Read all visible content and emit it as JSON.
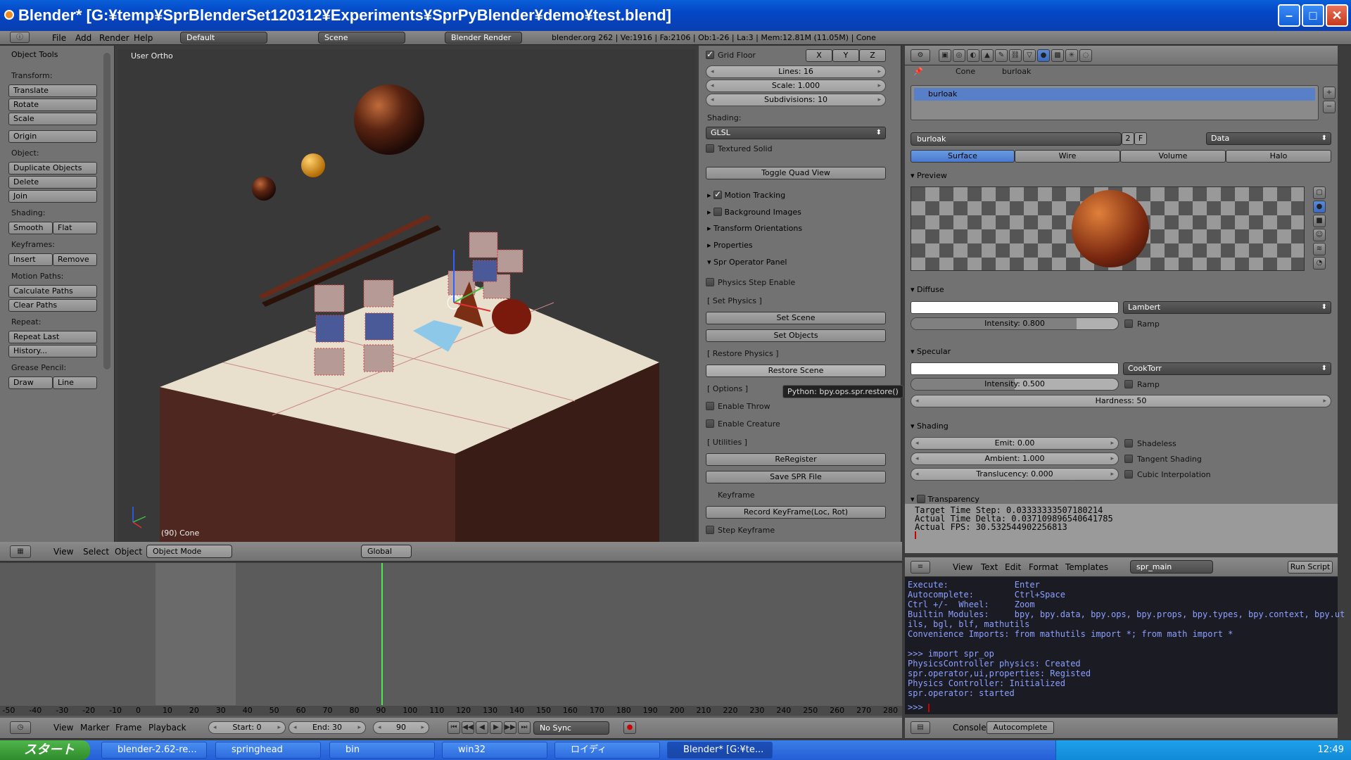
{
  "window": {
    "title": "Blender* [G:¥temp¥SprBlenderSet120312¥Experiments¥SprPyBlender¥demo¥test.blend]",
    "min": "–",
    "max": "□",
    "close": "✕"
  },
  "info_header": {
    "menus": [
      "File",
      "Add",
      "Render",
      "Help"
    ],
    "layout": "Default",
    "scene": "Scene",
    "engine": "Blender Render",
    "stats": "blender.org 262 | Ve:1916 | Fa:2106 | Ob:1-26 | La:3 | Mem:12.81M (11.05M) | Cone"
  },
  "tool_shelf": {
    "header": "Object Tools",
    "transform_label": "Transform:",
    "translate": "Translate",
    "rotate": "Rotate",
    "scale": "Scale",
    "origin": "Origin",
    "object_label": "Object:",
    "duplicate": "Duplicate Objects",
    "delete": "Delete",
    "join": "Join",
    "shading_label": "Shading:",
    "smooth": "Smooth",
    "flat": "Flat",
    "keyframes_label": "Keyframes:",
    "insert": "Insert",
    "remove": "Remove",
    "motion_label": "Motion Paths:",
    "calc_paths": "Calculate Paths",
    "clear_paths": "Clear Paths",
    "repeat_label": "Repeat:",
    "repeat_last": "Repeat Last",
    "history": "History...",
    "grease_label": "Grease Pencil:",
    "draw": "Draw",
    "line": "Line"
  },
  "viewport": {
    "view_name": "User Ortho",
    "object_info": "(90) Cone",
    "tooltip": "Python: bpy.ops.spr.restore()",
    "menus": [
      "View",
      "Select",
      "Object"
    ],
    "mode": "Object Mode",
    "orientation": "Global"
  },
  "properties_panel": {
    "grid_floor": "Grid Floor",
    "x": "X",
    "y": "Y",
    "z": "Z",
    "lines": "Lines: 16",
    "scale": "Scale: 1.000",
    "subdivisions": "Subdivisions: 10",
    "shading_label": "Shading:",
    "shading_value": "GLSL",
    "textured_solid": "Textured Solid",
    "toggle_quad": "Toggle Quad View",
    "motion_tracking": "Motion Tracking",
    "background_images": "Background Images",
    "transform_orientations": "Transform Orientations",
    "properties": "Properties",
    "spr_panel": "Spr Operator Panel",
    "physics_step": "Physics Step Enable",
    "set_physics": "[ Set Physics ]",
    "set_scene": "Set Scene",
    "set_objects": "Set Objects",
    "restore_physics": "[ Restore Physics ]",
    "restore_scene": "Restore Scene",
    "options": "[ Options ]",
    "enable_throw": "Enable Throw",
    "enable_creature": "Enable Creature",
    "utilities": "[ Utilities ]",
    "reregister": "ReRegister",
    "save_spr": "Save SPR File",
    "keyframe": "Keyframe",
    "record_keyframe": "Record KeyFrame(Loc, Rot)",
    "step_keyframe": "Step Keyframe"
  },
  "material": {
    "breadcrumb_cone": "Cone",
    "breadcrumb_mat": "burloak",
    "slot": "burloak",
    "name": "burloak",
    "users": "2",
    "fake": "F",
    "link": "Data",
    "tabs": [
      "Surface",
      "Wire",
      "Volume",
      "Halo"
    ],
    "preview": "Preview",
    "diffuse": "Diffuse",
    "diffuse_shader": "Lambert",
    "diffuse_intensity": "Intensity: 0.800",
    "diffuse_intensity_value": 0.8,
    "ramp": "Ramp",
    "specular": "Specular",
    "specular_shader": "CookTorr",
    "specular_intensity": "Intensity: 0.500",
    "specular_intensity_value": 0.5,
    "hardness": "Hardness: 50",
    "shading": "Shading",
    "emit": "Emit: 0.00",
    "ambient": "Ambient: 1.000",
    "translucency": "Translucency: 0.000",
    "shadeless": "Shadeless",
    "tangent": "Tangent Shading",
    "cubic": "Cubic Interpolation",
    "transparency": "Transparency"
  },
  "info_text": [
    "Target Time Step: 0.03333333507180214",
    "Actual Time Delta: 0.037109896540641785",
    "Actual FPS: 30.532544902256813"
  ],
  "text_editor": {
    "menus": [
      "View",
      "Text",
      "Edit",
      "Format",
      "Templates"
    ],
    "script": "spr_main",
    "run": "Run Script"
  },
  "console": {
    "lines": [
      "Execute:             Enter",
      "Autocomplete:        Ctrl+Space",
      "Ctrl +/-  Wheel:     Zoom",
      "Builtin Modules:     bpy, bpy.data, bpy.ops, bpy.props, bpy.types, bpy.context, bpy.ut",
      "ils, bgl, blf, mathutils",
      "Convenience Imports: from mathutils import *; from math import *",
      "",
      ">>> import spr_op",
      "PhysicsController physics: Created",
      "spr.operator,ui,properties: Registed",
      "Physics Controller: Initialized",
      "spr.operator: started"
    ],
    "prompt": ">>> ",
    "footer_console": "Console",
    "footer_autocomplete": "Autocomplete"
  },
  "timeline": {
    "ticks": [
      "-50",
      "-40",
      "-30",
      "-20",
      "-10",
      "0",
      "10",
      "20",
      "30",
      "40",
      "50",
      "60",
      "70",
      "80",
      "90",
      "100",
      "110",
      "120",
      "130",
      "140",
      "150",
      "160",
      "170",
      "180",
      "190",
      "200",
      "210",
      "220",
      "230",
      "240",
      "250",
      "260",
      "270",
      "280"
    ],
    "tick_values": [
      -50,
      -40,
      -30,
      -20,
      -10,
      0,
      10,
      20,
      30,
      40,
      50,
      60,
      70,
      80,
      90,
      100,
      110,
      120,
      130,
      140,
      150,
      160,
      170,
      180,
      190,
      200,
      210,
      220,
      230,
      240,
      250,
      260,
      270,
      280
    ],
    "range": [
      -53,
      285
    ],
    "menus": [
      "View",
      "Marker",
      "Frame",
      "Playback"
    ],
    "start": "Start: 0",
    "end": "End: 30",
    "current": "90",
    "current_value": 90,
    "start_value": 0,
    "end_value": 30,
    "sync": "No Sync"
  },
  "taskbar": {
    "start": "スタート",
    "tasks": [
      "blender-2.62-re...",
      "springhead",
      "bin",
      "win32",
      "ロイディ",
      "Blender* [G:¥te..."
    ],
    "clock": "12:49"
  }
}
